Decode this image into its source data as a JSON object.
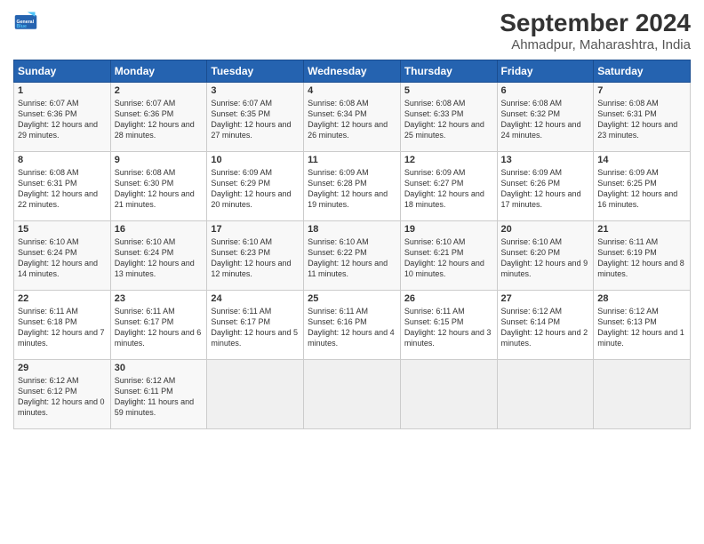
{
  "logo": {
    "line1": "General",
    "line2": "Blue"
  },
  "title": "September 2024",
  "subtitle": "Ahmadpur, Maharashtra, India",
  "headers": [
    "Sunday",
    "Monday",
    "Tuesday",
    "Wednesday",
    "Thursday",
    "Friday",
    "Saturday"
  ],
  "weeks": [
    [
      {
        "day": "1",
        "sunrise": "Sunrise: 6:07 AM",
        "sunset": "Sunset: 6:36 PM",
        "daylight": "Daylight: 12 hours and 29 minutes."
      },
      {
        "day": "2",
        "sunrise": "Sunrise: 6:07 AM",
        "sunset": "Sunset: 6:36 PM",
        "daylight": "Daylight: 12 hours and 28 minutes."
      },
      {
        "day": "3",
        "sunrise": "Sunrise: 6:07 AM",
        "sunset": "Sunset: 6:35 PM",
        "daylight": "Daylight: 12 hours and 27 minutes."
      },
      {
        "day": "4",
        "sunrise": "Sunrise: 6:08 AM",
        "sunset": "Sunset: 6:34 PM",
        "daylight": "Daylight: 12 hours and 26 minutes."
      },
      {
        "day": "5",
        "sunrise": "Sunrise: 6:08 AM",
        "sunset": "Sunset: 6:33 PM",
        "daylight": "Daylight: 12 hours and 25 minutes."
      },
      {
        "day": "6",
        "sunrise": "Sunrise: 6:08 AM",
        "sunset": "Sunset: 6:32 PM",
        "daylight": "Daylight: 12 hours and 24 minutes."
      },
      {
        "day": "7",
        "sunrise": "Sunrise: 6:08 AM",
        "sunset": "Sunset: 6:31 PM",
        "daylight": "Daylight: 12 hours and 23 minutes."
      }
    ],
    [
      {
        "day": "8",
        "sunrise": "Sunrise: 6:08 AM",
        "sunset": "Sunset: 6:31 PM",
        "daylight": "Daylight: 12 hours and 22 minutes."
      },
      {
        "day": "9",
        "sunrise": "Sunrise: 6:08 AM",
        "sunset": "Sunset: 6:30 PM",
        "daylight": "Daylight: 12 hours and 21 minutes."
      },
      {
        "day": "10",
        "sunrise": "Sunrise: 6:09 AM",
        "sunset": "Sunset: 6:29 PM",
        "daylight": "Daylight: 12 hours and 20 minutes."
      },
      {
        "day": "11",
        "sunrise": "Sunrise: 6:09 AM",
        "sunset": "Sunset: 6:28 PM",
        "daylight": "Daylight: 12 hours and 19 minutes."
      },
      {
        "day": "12",
        "sunrise": "Sunrise: 6:09 AM",
        "sunset": "Sunset: 6:27 PM",
        "daylight": "Daylight: 12 hours and 18 minutes."
      },
      {
        "day": "13",
        "sunrise": "Sunrise: 6:09 AM",
        "sunset": "Sunset: 6:26 PM",
        "daylight": "Daylight: 12 hours and 17 minutes."
      },
      {
        "day": "14",
        "sunrise": "Sunrise: 6:09 AM",
        "sunset": "Sunset: 6:25 PM",
        "daylight": "Daylight: 12 hours and 16 minutes."
      }
    ],
    [
      {
        "day": "15",
        "sunrise": "Sunrise: 6:10 AM",
        "sunset": "Sunset: 6:24 PM",
        "daylight": "Daylight: 12 hours and 14 minutes."
      },
      {
        "day": "16",
        "sunrise": "Sunrise: 6:10 AM",
        "sunset": "Sunset: 6:24 PM",
        "daylight": "Daylight: 12 hours and 13 minutes."
      },
      {
        "day": "17",
        "sunrise": "Sunrise: 6:10 AM",
        "sunset": "Sunset: 6:23 PM",
        "daylight": "Daylight: 12 hours and 12 minutes."
      },
      {
        "day": "18",
        "sunrise": "Sunrise: 6:10 AM",
        "sunset": "Sunset: 6:22 PM",
        "daylight": "Daylight: 12 hours and 11 minutes."
      },
      {
        "day": "19",
        "sunrise": "Sunrise: 6:10 AM",
        "sunset": "Sunset: 6:21 PM",
        "daylight": "Daylight: 12 hours and 10 minutes."
      },
      {
        "day": "20",
        "sunrise": "Sunrise: 6:10 AM",
        "sunset": "Sunset: 6:20 PM",
        "daylight": "Daylight: 12 hours and 9 minutes."
      },
      {
        "day": "21",
        "sunrise": "Sunrise: 6:11 AM",
        "sunset": "Sunset: 6:19 PM",
        "daylight": "Daylight: 12 hours and 8 minutes."
      }
    ],
    [
      {
        "day": "22",
        "sunrise": "Sunrise: 6:11 AM",
        "sunset": "Sunset: 6:18 PM",
        "daylight": "Daylight: 12 hours and 7 minutes."
      },
      {
        "day": "23",
        "sunrise": "Sunrise: 6:11 AM",
        "sunset": "Sunset: 6:17 PM",
        "daylight": "Daylight: 12 hours and 6 minutes."
      },
      {
        "day": "24",
        "sunrise": "Sunrise: 6:11 AM",
        "sunset": "Sunset: 6:17 PM",
        "daylight": "Daylight: 12 hours and 5 minutes."
      },
      {
        "day": "25",
        "sunrise": "Sunrise: 6:11 AM",
        "sunset": "Sunset: 6:16 PM",
        "daylight": "Daylight: 12 hours and 4 minutes."
      },
      {
        "day": "26",
        "sunrise": "Sunrise: 6:11 AM",
        "sunset": "Sunset: 6:15 PM",
        "daylight": "Daylight: 12 hours and 3 minutes."
      },
      {
        "day": "27",
        "sunrise": "Sunrise: 6:12 AM",
        "sunset": "Sunset: 6:14 PM",
        "daylight": "Daylight: 12 hours and 2 minutes."
      },
      {
        "day": "28",
        "sunrise": "Sunrise: 6:12 AM",
        "sunset": "Sunset: 6:13 PM",
        "daylight": "Daylight: 12 hours and 1 minute."
      }
    ],
    [
      {
        "day": "29",
        "sunrise": "Sunrise: 6:12 AM",
        "sunset": "Sunset: 6:12 PM",
        "daylight": "Daylight: 12 hours and 0 minutes."
      },
      {
        "day": "30",
        "sunrise": "Sunrise: 6:12 AM",
        "sunset": "Sunset: 6:11 PM",
        "daylight": "Daylight: 11 hours and 59 minutes."
      },
      null,
      null,
      null,
      null,
      null
    ]
  ]
}
